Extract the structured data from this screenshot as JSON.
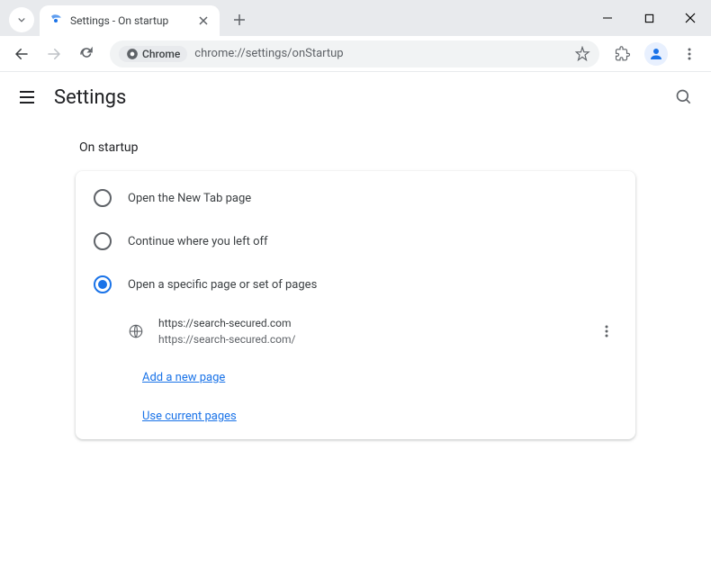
{
  "window": {
    "tab_title": "Settings - On startup"
  },
  "toolbar": {
    "chrome_chip": "Chrome",
    "url": "chrome://settings/onStartup"
  },
  "header": {
    "title": "Settings"
  },
  "section": {
    "title": "On startup",
    "options": {
      "new_tab": "Open the New Tab page",
      "continue": "Continue where you left off",
      "specific": "Open a specific page or set of pages"
    },
    "startup_page": {
      "title": "https://search-secured.com",
      "url": "https://search-secured.com/"
    },
    "add_page": "Add a new page",
    "use_current": "Use current pages"
  }
}
